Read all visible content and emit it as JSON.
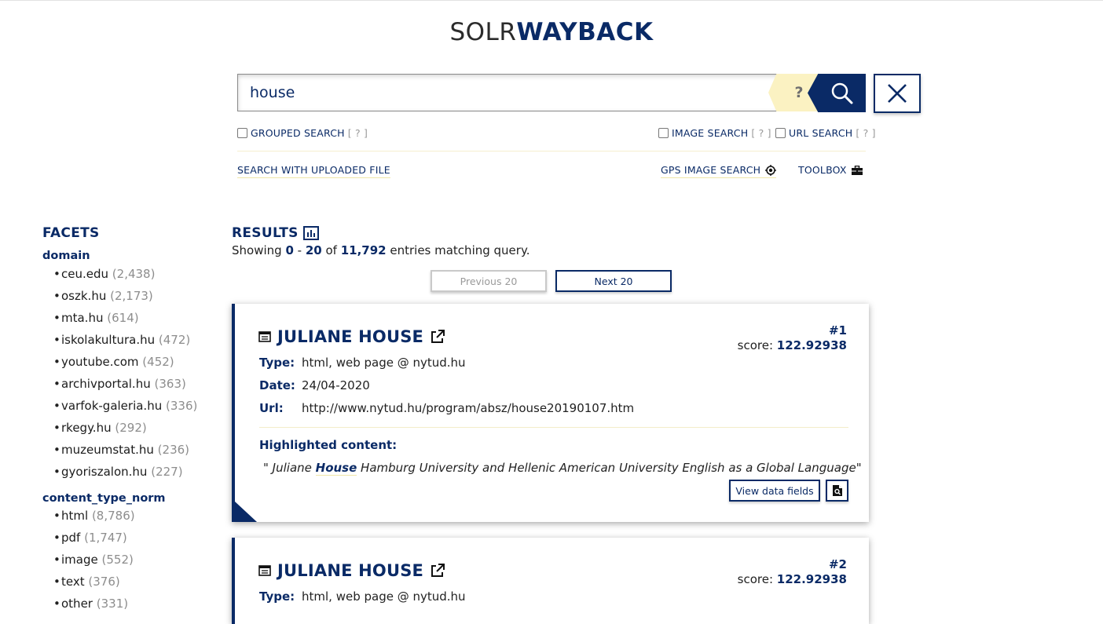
{
  "logo": {
    "part1": "SOLR",
    "part2": "WAYBACK"
  },
  "search": {
    "value": "house",
    "help_label": "?"
  },
  "options": {
    "grouped": {
      "label": "GROUPED SEARCH",
      "hint": "[ ? ]"
    },
    "image": {
      "label": "IMAGE SEARCH",
      "hint": "[ ? ]"
    },
    "url": {
      "label": "URL SEARCH",
      "hint": "[ ? ]"
    }
  },
  "links": {
    "upload": "SEARCH WITH UPLOADED FILE",
    "gps": "GPS IMAGE SEARCH",
    "toolbox": "TOOLBOX"
  },
  "facets": {
    "title": "FACETS",
    "domain": {
      "title": "domain",
      "items": [
        {
          "name": "ceu.edu",
          "count": "(2,438)"
        },
        {
          "name": "oszk.hu",
          "count": "(2,173)"
        },
        {
          "name": "mta.hu",
          "count": "(614)"
        },
        {
          "name": "iskolakultura.hu",
          "count": "(472)"
        },
        {
          "name": "youtube.com",
          "count": "(452)"
        },
        {
          "name": "archivportal.hu",
          "count": "(363)"
        },
        {
          "name": "varfok-galeria.hu",
          "count": "(336)"
        },
        {
          "name": "rkegy.hu",
          "count": "(292)"
        },
        {
          "name": "muzeumstat.hu",
          "count": "(236)"
        },
        {
          "name": "gyoriszalon.hu",
          "count": "(227)"
        }
      ]
    },
    "content_type": {
      "title": "content_type_norm",
      "items": [
        {
          "name": "html",
          "count": "(8,786)"
        },
        {
          "name": "pdf",
          "count": "(1,747)"
        },
        {
          "name": "image",
          "count": "(552)"
        },
        {
          "name": "text",
          "count": "(376)"
        },
        {
          "name": "other",
          "count": "(331)"
        }
      ]
    }
  },
  "results": {
    "title": "RESULTS",
    "showing_prefix": "Showing ",
    "range_start": "0",
    "range_sep": " - ",
    "range_end": "20",
    "of_text": " of ",
    "total": "11,792",
    "suffix": " entries matching query.",
    "prev_label": "Previous 20",
    "next_label": "Next 20",
    "labels": {
      "type": "Type:",
      "date": "Date:",
      "url": "Url:",
      "highlighted": "Highlighted content:",
      "score": "score: ",
      "view_fields": "View data fields"
    },
    "items": [
      {
        "title": "JULIANE HOUSE",
        "number": "#1",
        "score": "122.92938",
        "type": "html, web page @ nytud.hu",
        "date": "24/04-2020",
        "url": "http://www.nytud.hu/program/absz/house20190107.htm",
        "highlight_open": "\" ",
        "highlight_pre": "Juliane ",
        "highlight_em": "House",
        "highlight_post": " Hamburg University and Hellenic American University English as a Global Language",
        "highlight_close": "\""
      },
      {
        "title": "JULIANE HOUSE",
        "number": "#2",
        "score": "122.92938",
        "type": "html, web page @ nytud.hu"
      }
    ]
  }
}
